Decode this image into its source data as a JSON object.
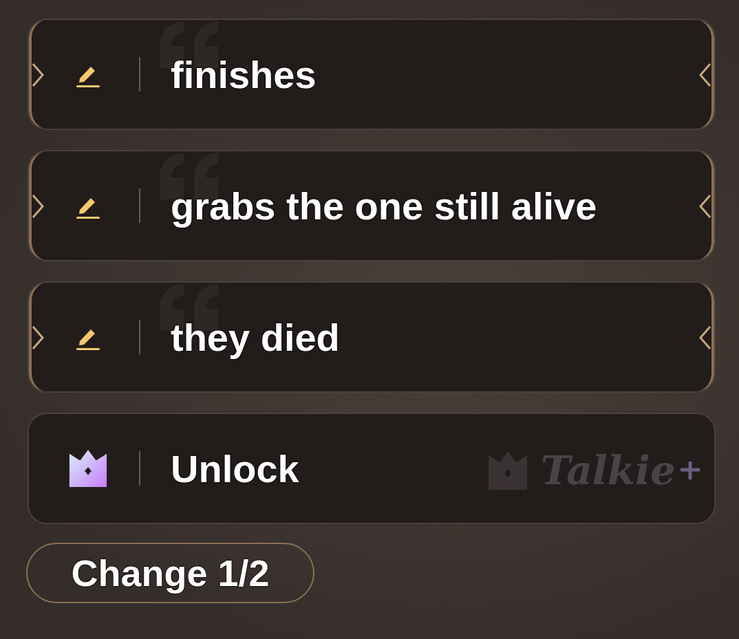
{
  "options": [
    {
      "kind": "reply",
      "text": "finishes"
    },
    {
      "kind": "reply",
      "text": "grabs the one still alive"
    },
    {
      "kind": "reply",
      "text": "they died"
    },
    {
      "kind": "unlock",
      "text": "Unlock",
      "brand": "Talkie"
    }
  ],
  "change_button": {
    "label": "Change 1/2"
  }
}
